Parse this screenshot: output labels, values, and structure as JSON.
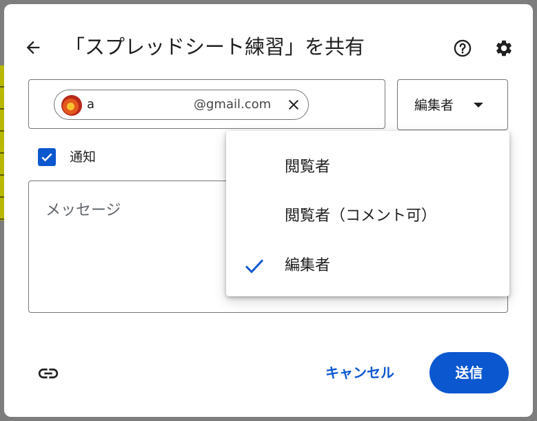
{
  "dialog": {
    "title": "「スプレッドシート練習」を共有"
  },
  "recipient": {
    "name": "a",
    "email": "@gmail.com"
  },
  "role_select": {
    "selected": "編集者"
  },
  "notify": {
    "label": "通知",
    "checked": true
  },
  "message": {
    "placeholder": "メッセージ"
  },
  "role_menu": {
    "items": [
      {
        "label": "閲覧者",
        "selected": false
      },
      {
        "label": "閲覧者（コメント可）",
        "selected": false
      },
      {
        "label": "編集者",
        "selected": true
      }
    ]
  },
  "footer": {
    "cancel_label": "キャンセル",
    "send_label": "送信"
  },
  "icons": {
    "back": "arrow-back-icon",
    "help": "help-circle-icon",
    "settings": "gear-icon",
    "remove": "close-icon",
    "check": "check-icon",
    "link": "link-icon"
  },
  "colors": {
    "accent": "#0b57d0",
    "text": "#1f1f1f",
    "border": "#747775"
  }
}
